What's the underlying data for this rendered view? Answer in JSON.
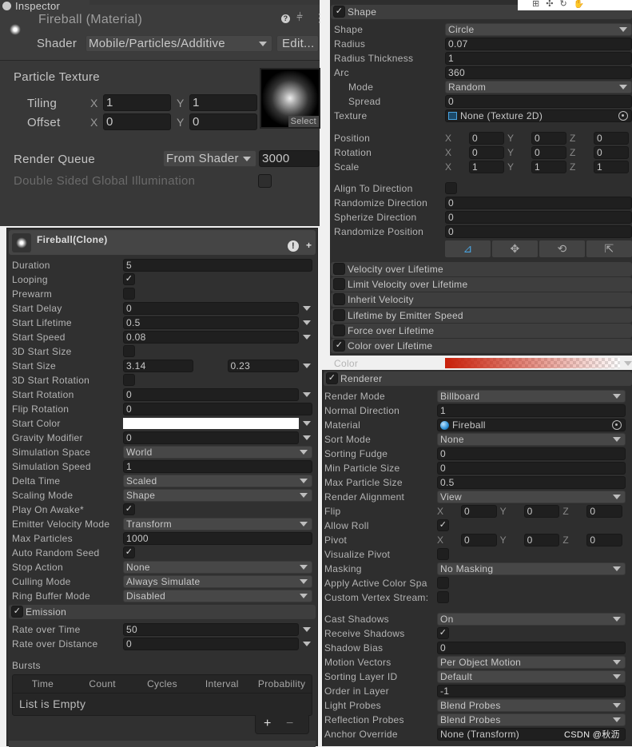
{
  "material": {
    "tab_label": "Inspector",
    "title": "Fireball (Material)",
    "shader_label": "Shader",
    "shader_value": "Mobile/Particles/Additive",
    "edit_button": "Edit...",
    "texture_label": "Particle Texture",
    "tiling_label": "Tiling",
    "tiling_x": "1",
    "tiling_y": "1",
    "offset_label": "Offset",
    "offset_x": "0",
    "offset_y": "0",
    "x_label": "X",
    "y_label": "Y",
    "select_button": "Select",
    "render_queue_label": "Render Queue",
    "render_queue_mode": "From Shader",
    "render_queue_value": "3000",
    "double_sided_label": "Double Sided Global Illumination",
    "icons": [
      "help-icon",
      "preset-icon",
      "more-icon"
    ]
  },
  "particle": {
    "title": "Fireball(Clone)",
    "rows": [
      {
        "label": "Duration",
        "kind": "field",
        "value": "5"
      },
      {
        "label": "Looping",
        "kind": "check",
        "checked": true
      },
      {
        "label": "Prewarm",
        "kind": "check",
        "checked": false
      },
      {
        "label": "Start Delay",
        "kind": "curve",
        "value": "0"
      },
      {
        "label": "Start Lifetime",
        "kind": "curve",
        "value": "0.5"
      },
      {
        "label": "Start Speed",
        "kind": "curve",
        "value": "0.08"
      },
      {
        "label": "3D Start Size",
        "kind": "check",
        "checked": false
      },
      {
        "label": "Start Size",
        "kind": "curve2",
        "value": "3.14",
        "value2": "0.23"
      },
      {
        "label": "3D Start Rotation",
        "kind": "check",
        "checked": false
      },
      {
        "label": "Start Rotation",
        "kind": "curve",
        "value": "0"
      },
      {
        "label": "Flip Rotation",
        "kind": "field",
        "value": "0"
      },
      {
        "label": "Start Color",
        "kind": "color",
        "color": "#ffffff"
      },
      {
        "label": "Gravity Modifier",
        "kind": "curve",
        "value": "0"
      },
      {
        "label": "Simulation Space",
        "kind": "dropdown",
        "value": "World"
      },
      {
        "label": "Simulation Speed",
        "kind": "field",
        "value": "1"
      },
      {
        "label": "Delta Time",
        "kind": "dropdown",
        "value": "Scaled"
      },
      {
        "label": "Scaling Mode",
        "kind": "dropdown",
        "value": "Shape"
      },
      {
        "label": "Play On Awake*",
        "kind": "check",
        "checked": true
      },
      {
        "label": "Emitter Velocity Mode",
        "kind": "dropdown",
        "value": "Transform"
      },
      {
        "label": "Max Particles",
        "kind": "field",
        "value": "1000"
      },
      {
        "label": "Auto Random Seed",
        "kind": "check",
        "checked": true
      },
      {
        "label": "Stop Action",
        "kind": "dropdown",
        "value": "None"
      },
      {
        "label": "Culling Mode",
        "kind": "dropdown",
        "value": "Always Simulate"
      },
      {
        "label": "Ring Buffer Mode",
        "kind": "dropdown",
        "value": "Disabled"
      }
    ],
    "emission": {
      "title": "Emission",
      "enabled": true,
      "rows": [
        {
          "label": "Rate over Time",
          "kind": "curve",
          "value": "50"
        },
        {
          "label": "Rate over Distance",
          "kind": "curve",
          "value": "0"
        }
      ],
      "bursts_label": "Bursts",
      "burst_columns": [
        "Time",
        "Count",
        "Cycles",
        "Interval",
        "Probability"
      ],
      "empty_text": "List is Empty",
      "add_label": "+",
      "remove_label": "−"
    }
  },
  "shape": {
    "title": "Shape",
    "enabled": true,
    "rows": [
      {
        "label": "Shape",
        "kind": "dropdown",
        "value": "Circle"
      },
      {
        "label": "Radius",
        "kind": "field",
        "value": "0.07"
      },
      {
        "label": "Radius Thickness",
        "kind": "field",
        "value": "1"
      },
      {
        "label": "Arc",
        "kind": "field",
        "value": "360"
      },
      {
        "label": "Mode",
        "kind": "dropdown",
        "value": "Random",
        "indent": true
      },
      {
        "label": "Spread",
        "kind": "field",
        "value": "0",
        "indent": true
      },
      {
        "label": "Texture",
        "kind": "object",
        "value": "None (Texture 2D)",
        "icon": "texture-icon"
      },
      {
        "label": "Position",
        "kind": "xyz",
        "values": [
          "0",
          "0",
          "0"
        ]
      },
      {
        "label": "Rotation",
        "kind": "xyz",
        "values": [
          "0",
          "0",
          "0"
        ]
      },
      {
        "label": "Scale",
        "kind": "xyz",
        "values": [
          "1",
          "1",
          "1"
        ]
      },
      {
        "label": "Align To Direction",
        "kind": "check",
        "checked": false
      },
      {
        "label": "Randomize Direction",
        "kind": "field",
        "value": "0"
      },
      {
        "label": "Spherize Direction",
        "kind": "field",
        "value": "0"
      },
      {
        "label": "Randomize Position",
        "kind": "field",
        "value": "0"
      }
    ],
    "tool_icons": [
      "edit-shape-icon",
      "move-icon",
      "rotate-icon",
      "scale-icon"
    ],
    "xyz_labels": [
      "X",
      "Y",
      "Z"
    ]
  },
  "modules": [
    {
      "title": "Velocity over Lifetime",
      "enabled": false
    },
    {
      "title": "Limit Velocity over Lifetime",
      "enabled": false
    },
    {
      "title": "Inherit Velocity",
      "enabled": false
    },
    {
      "title": "Lifetime by Emitter Speed",
      "enabled": false
    },
    {
      "title": "Force over Lifetime",
      "enabled": false
    },
    {
      "title": "Color over Lifetime",
      "enabled": true
    }
  ],
  "color_over_lifetime": {
    "label": "Color",
    "gradient_start": "#c8200a",
    "gradient_end": "#ffffff"
  },
  "renderer": {
    "title": "Renderer",
    "enabled": true,
    "rows": [
      {
        "label": "Render Mode",
        "kind": "dropdown",
        "value": "Billboard"
      },
      {
        "label": "Normal Direction",
        "kind": "field",
        "value": "1"
      },
      {
        "label": "Material",
        "kind": "object",
        "value": "Fireball",
        "icon": "material-icon"
      },
      {
        "label": "Sort Mode",
        "kind": "dropdown",
        "value": "None"
      },
      {
        "label": "Sorting Fudge",
        "kind": "field",
        "value": "0"
      },
      {
        "label": "Min Particle Size",
        "kind": "field",
        "value": "0"
      },
      {
        "label": "Max Particle Size",
        "kind": "field",
        "value": "0.5"
      },
      {
        "label": "Render Alignment",
        "kind": "dropdown",
        "value": "View"
      },
      {
        "label": "Flip",
        "kind": "xyz",
        "values": [
          "0",
          "0",
          "0"
        ]
      },
      {
        "label": "Allow Roll",
        "kind": "check",
        "checked": true
      },
      {
        "label": "Pivot",
        "kind": "xyz",
        "values": [
          "0",
          "0",
          "0"
        ]
      },
      {
        "label": "Visualize Pivot",
        "kind": "check",
        "checked": false
      },
      {
        "label": "Masking",
        "kind": "dropdown",
        "value": "No Masking"
      },
      {
        "label": "Apply Active Color Spa",
        "kind": "check",
        "checked": false
      },
      {
        "label": "Custom Vertex Stream:",
        "kind": "check",
        "checked": false
      },
      {
        "label": "Cast Shadows",
        "kind": "dropdown",
        "value": "On"
      },
      {
        "label": "Receive Shadows",
        "kind": "check",
        "checked": true
      },
      {
        "label": "Shadow Bias",
        "kind": "field",
        "value": "0"
      },
      {
        "label": "Motion Vectors",
        "kind": "dropdown",
        "value": "Per Object Motion"
      },
      {
        "label": "Sorting Layer ID",
        "kind": "dropdown",
        "value": "Default"
      },
      {
        "label": "Order in Layer",
        "kind": "field",
        "value": "-1"
      },
      {
        "label": "Light Probes",
        "kind": "dropdown",
        "value": "Blend Probes"
      },
      {
        "label": "Reflection Probes",
        "kind": "dropdown",
        "value": "Blend Probes"
      },
      {
        "label": "Anchor Override",
        "kind": "field",
        "value": "None (Transform)"
      }
    ]
  },
  "watermark": "CSDN @秋沥"
}
